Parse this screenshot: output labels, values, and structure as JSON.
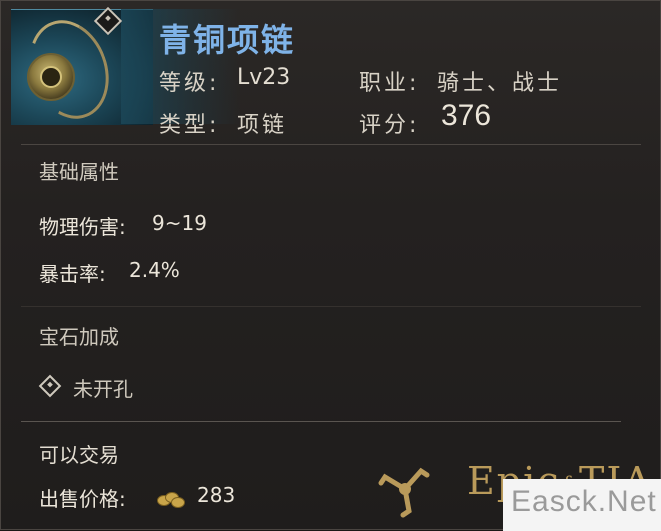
{
  "item": {
    "name": "青铜项链",
    "level_label": "等级:",
    "level_value": "Lv23",
    "class_label": "职业:",
    "class_value": "骑士、战士",
    "type_label": "类型:",
    "type_value": "项链",
    "score_label": "评分:",
    "score_value": "376",
    "icon": "bronze-necklace-icon"
  },
  "base_attributes": {
    "title": "基础属性",
    "stats": [
      {
        "label": "物理伤害:",
        "value": "9~19"
      },
      {
        "label": "暴击率:",
        "value": "2.4%"
      }
    ]
  },
  "gem_bonus": {
    "title": "宝石加成",
    "slot_text": "未开孔",
    "icon": "gem-socket-icon"
  },
  "trade": {
    "tradable_text": "可以交易",
    "sell_label": "出售价格:",
    "sell_price": "283",
    "icon": "gold-coin-icon"
  },
  "branding": {
    "logo_part1": "Epic",
    "logo_part2": "of",
    "logo_part3": "TIA",
    "watermark": "Easck.Net"
  },
  "colors": {
    "title_blue": "#7fb3e8",
    "gold": "#b99a5a",
    "text": "#d8d2c6"
  }
}
